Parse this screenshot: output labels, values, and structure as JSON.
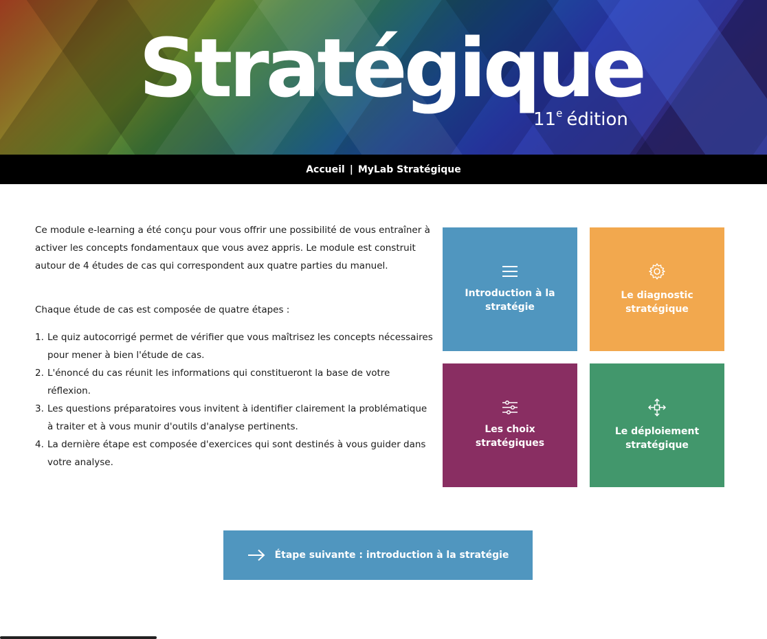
{
  "banner": {
    "title": "Stratégique",
    "edition_number": "11",
    "edition_sup": "e",
    "edition_word": "édition"
  },
  "nav": {
    "items": [
      {
        "label": "Accueil"
      },
      {
        "label": "MyLab Stratégique"
      }
    ],
    "separator": "|"
  },
  "content": {
    "intro": "Ce module e-learning a été conçu pour vous offrir une possibilité de vous entraîner à activer les concepts fondamentaux que vous avez appris. Le module est construit autour de 4 études de cas qui correspondent aux quatre parties du manuel.",
    "steps_title": "Chaque étude de cas est composée de quatre étapes :",
    "steps": [
      {
        "num": "1.",
        "text": "Le quiz autocorrigé permet de vérifier que vous maîtrisez les concepts nécessaires pour mener à bien l'étude de cas."
      },
      {
        "num": "2.",
        "text": "L'énoncé du cas réunit les informations qui constitueront la base de votre réflexion."
      },
      {
        "num": "3.",
        "text": "Les questions préparatoires vous invitent à identifier clairement la problématique à traiter et à vous munir d'outils d'analyse pertinents."
      },
      {
        "num": "4.",
        "text": "La dernière étape est composée d'exercices qui sont destinés à vous guider dans votre analyse."
      }
    ]
  },
  "tiles": [
    {
      "label": "Introduction à la stratégie",
      "icon": "menu-icon",
      "color": "#5096bf"
    },
    {
      "label": "Le diagnostic stratégique",
      "icon": "gear-icon",
      "color": "#f2a84e"
    },
    {
      "label": "Les choix stratégiques",
      "icon": "sliders-icon",
      "color": "#892e62"
    },
    {
      "label": "Le déploiement stratégique",
      "icon": "move-arrows-icon",
      "color": "#42976c"
    }
  ],
  "next_button": {
    "label": "Étape suivante : introduction à la stratégie",
    "icon": "arrow-right-icon",
    "color": "#5096bf"
  }
}
